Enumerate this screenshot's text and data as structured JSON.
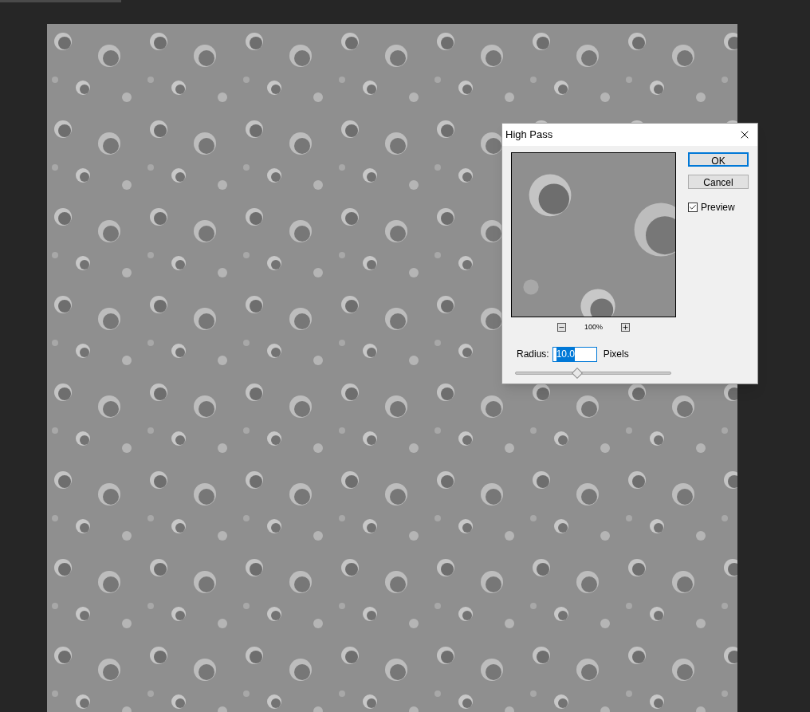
{
  "dialog": {
    "title": "High Pass",
    "preview": {
      "zoom": "100%"
    },
    "radius": {
      "label": "Radius:",
      "value": "10.0",
      "value_selected": true,
      "unit": "Pixels",
      "level": 0.4
    },
    "buttons": [
      {
        "label": "OK",
        "default": true
      },
      {
        "label": "Cancel",
        "default": false
      }
    ],
    "preview_checkbox": {
      "label": "Preview",
      "checked": true
    }
  }
}
